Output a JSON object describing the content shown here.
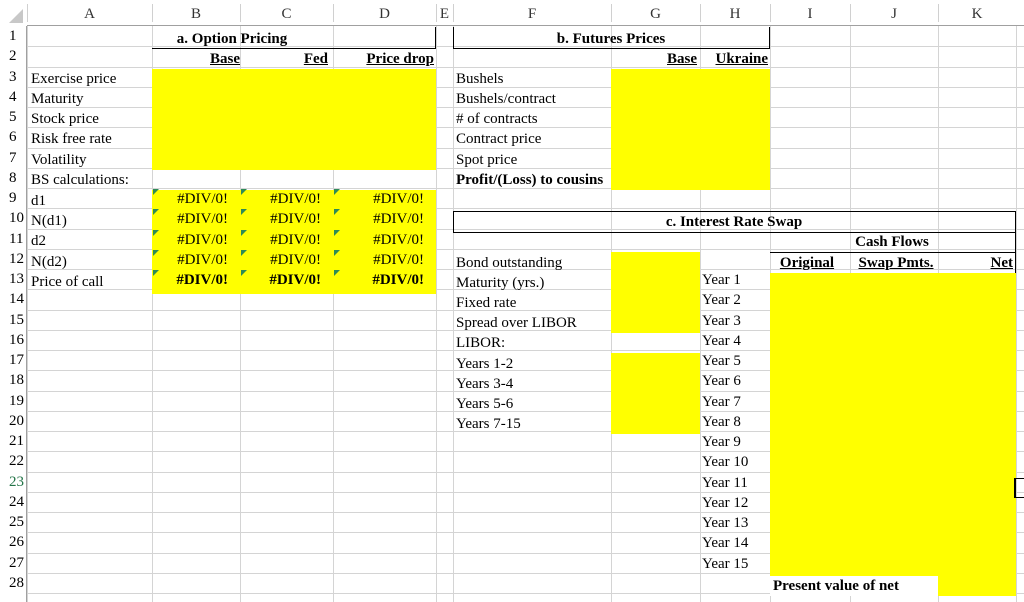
{
  "columns": [
    "A",
    "B",
    "C",
    "D",
    "E",
    "F",
    "G",
    "H",
    "I",
    "J",
    "K"
  ],
  "rows": [
    "1",
    "2",
    "3",
    "4",
    "5",
    "6",
    "7",
    "8",
    "9",
    "10",
    "11",
    "12",
    "13",
    "14",
    "15",
    "16",
    "17",
    "18",
    "19",
    "20",
    "21",
    "22",
    "23",
    "24",
    "25",
    "26",
    "27",
    "28"
  ],
  "colors": {
    "highlight": "#ffff00",
    "grid": "#d4d4d4",
    "error_marker": "#2e8b57"
  },
  "option_pricing": {
    "title": "a. Option Pricing",
    "headers": [
      "Base",
      "Fed",
      "Price drop"
    ],
    "inputs": [
      "Exercise price",
      "Maturity",
      "Stock price",
      "Risk free rate",
      "Volatility"
    ],
    "calc_label": "BS calculations:",
    "calc_rows": [
      {
        "label": "d1",
        "values": [
          "#DIV/0!",
          "#DIV/0!",
          "#DIV/0!"
        ]
      },
      {
        "label": "N(d1)",
        "values": [
          "#DIV/0!",
          "#DIV/0!",
          "#DIV/0!"
        ]
      },
      {
        "label": "d2",
        "values": [
          "#DIV/0!",
          "#DIV/0!",
          "#DIV/0!"
        ]
      },
      {
        "label": "N(d2)",
        "values": [
          "#DIV/0!",
          "#DIV/0!",
          "#DIV/0!"
        ]
      },
      {
        "label": "Price of call",
        "values": [
          "#DIV/0!",
          "#DIV/0!",
          "#DIV/0!"
        ]
      }
    ]
  },
  "futures": {
    "title": "b. Futures Prices",
    "headers": [
      "Base",
      "Ukraine"
    ],
    "labels": [
      "Bushels",
      "Bushels/contract",
      "# of contracts",
      "Contract price",
      "Spot price",
      "Profit/(Loss) to cousins"
    ]
  },
  "swap": {
    "title": "c. Interest Rate Swap",
    "cash_flows_title": "Cash Flows",
    "headers": [
      "Original",
      "Swap Pmts.",
      "Net"
    ],
    "labels": [
      "Bond outstanding",
      "Maturity (yrs.)",
      "Fixed rate",
      "Spread over LIBOR",
      "LIBOR:",
      "Years 1-2",
      "Years 3-4",
      "Years 5-6",
      "Years 7-15"
    ],
    "years": [
      "Year 1",
      "Year 2",
      "Year 3",
      "Year 4",
      "Year 5",
      "Year 6",
      "Year 7",
      "Year 8",
      "Year 9",
      "Year 10",
      "Year 11",
      "Year 12",
      "Year 13",
      "Year 14",
      "Year 15"
    ],
    "pv_label": "Present value of net"
  }
}
